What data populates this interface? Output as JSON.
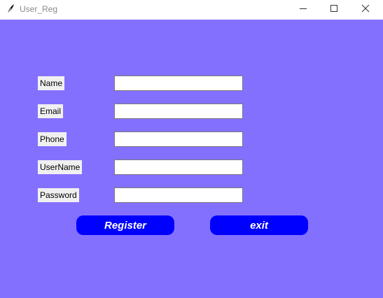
{
  "window": {
    "title": "User_Reg",
    "icon": "feather-icon",
    "controls": [
      "minimize-icon",
      "maximize-icon",
      "close-icon"
    ]
  },
  "colors": {
    "background": "#8470ff",
    "button_bg": "#0000ff",
    "button_text": "#ffffff",
    "label_bg": "#f0f0f0"
  },
  "form": {
    "fields": [
      {
        "label": "Name",
        "value": ""
      },
      {
        "label": "Email",
        "value": ""
      },
      {
        "label": "Phone",
        "value": ""
      },
      {
        "label": "UserName",
        "value": ""
      },
      {
        "label": "Password",
        "value": ""
      }
    ]
  },
  "buttons": {
    "register_label": "Register",
    "exit_label": "exit"
  }
}
